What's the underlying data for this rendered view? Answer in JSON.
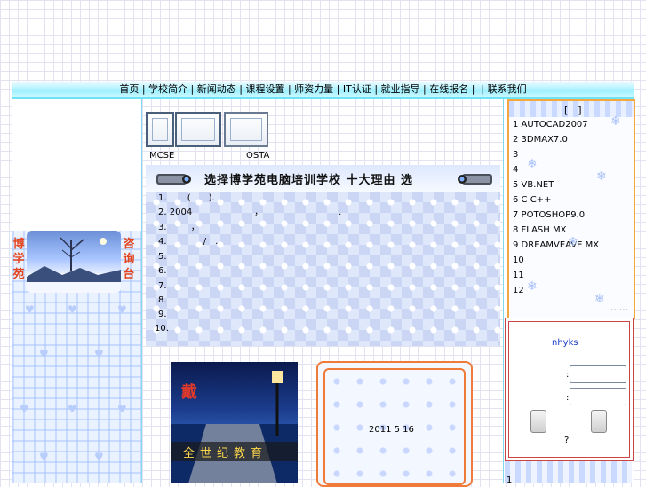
{
  "nav": {
    "items": [
      "首页",
      "学校简介",
      "新闻动态",
      "课程设置",
      "师资力量",
      "IT认证",
      "就业指导",
      "在线报名",
      "",
      "联系我们"
    ],
    "separator": " | "
  },
  "left": {
    "title_left_chars": [
      "博",
      "学",
      "苑"
    ],
    "title_right_chars": [
      "咨",
      "询",
      "台"
    ]
  },
  "certs": {
    "mcse_label": "MCSE",
    "osta_label": "OSTA"
  },
  "banner": {
    "text": "选择博学苑电脑培训学校  十大理由  选"
  },
  "reasons": [
    {
      "num": "1.",
      "text": "(　　)."
    },
    {
      "num": "2.",
      "text": "2004　　　　　　　，　　　　　　　　　."
    },
    {
      "num": "3.",
      "text": "，"
    },
    {
      "num": "4.",
      "text": "　/　."
    },
    {
      "num": "5.",
      "text": ""
    },
    {
      "num": "6.",
      "text": ""
    },
    {
      "num": "7.",
      "text": ""
    },
    {
      "num": "8.",
      "text": ""
    },
    {
      "num": "9.",
      "text": ""
    },
    {
      "num": "10.",
      "text": ""
    }
  ],
  "photo": {
    "glyph": "戴",
    "caption": "全世纪教育"
  },
  "notice": {
    "date": "2011 5 16"
  },
  "courses": {
    "header": "[　]",
    "items": [
      "1 AUTOCAD2007",
      "2 3DMAX7.0",
      "3",
      "4",
      "5 VB.NET",
      "6 C C++",
      "7 POTOSHOP9.0",
      "8 FLASH MX",
      "9 DREAMVEAVE MX",
      "10",
      "11",
      "12"
    ],
    "more": "……"
  },
  "login": {
    "title": "nhyks",
    "user_label": ":",
    "pass_label": ":",
    "help": "?"
  },
  "right_bottom": {
    "text": "1"
  },
  "colors": {
    "nav_bg": "#9ff0ff",
    "accent_orange": "#f4a640",
    "title_red": "#e3451e",
    "login_border": "#cc4444"
  }
}
